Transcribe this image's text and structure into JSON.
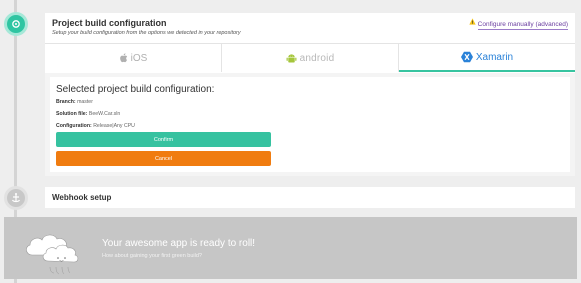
{
  "card": {
    "title": "Project build configuration",
    "subtitle": "Setup your build configuration from the options we detected in your repository",
    "manual_link": "Configure manually (advanced)"
  },
  "tabs": [
    {
      "label": "iOS",
      "icon": "apple-icon",
      "active": false
    },
    {
      "label": "android",
      "icon": "android-icon",
      "active": false
    },
    {
      "label": "Xamarin",
      "icon": "xamarin-icon",
      "active": true
    }
  ],
  "selected": {
    "title": "Selected project build configuration:",
    "branch_label": "Branch:",
    "branch_value": "master",
    "solution_label": "Solution file:",
    "solution_value": "BeeW.Car.sln",
    "config_label": "Configuration:",
    "config_value": "Release|Any CPU",
    "confirm": "Confirm",
    "cancel": "Cancel"
  },
  "webhook": {
    "title": "Webhook setup"
  },
  "banner": {
    "title": "Your awesome app is ready to roll!",
    "subtitle": "How about gaining your first green build?"
  },
  "colors": {
    "accent_green": "#36c2a0",
    "cancel_orange": "#f07c10",
    "xamarin_blue": "#2a82d8",
    "link_purple": "#6b3fa0"
  }
}
